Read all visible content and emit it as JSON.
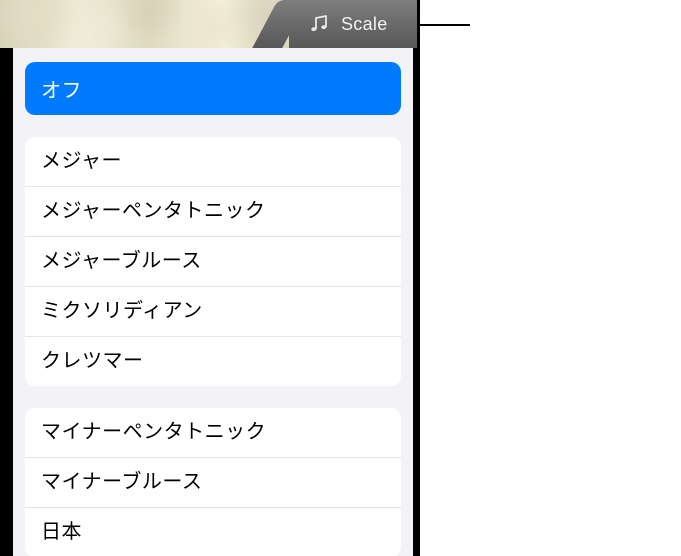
{
  "header": {
    "scale_label": "Scale",
    "icon_name": "notes-icon"
  },
  "selected": {
    "label": "オフ"
  },
  "group1": {
    "items": [
      {
        "label": "メジャー"
      },
      {
        "label": "メジャーペンタトニック"
      },
      {
        "label": "メジャーブルース"
      },
      {
        "label": "ミクソリディアン"
      },
      {
        "label": "クレツマー"
      }
    ]
  },
  "group2": {
    "items": [
      {
        "label": "マイナーペンタトニック"
      },
      {
        "label": "マイナーブルース"
      },
      {
        "label": "日本"
      }
    ]
  }
}
